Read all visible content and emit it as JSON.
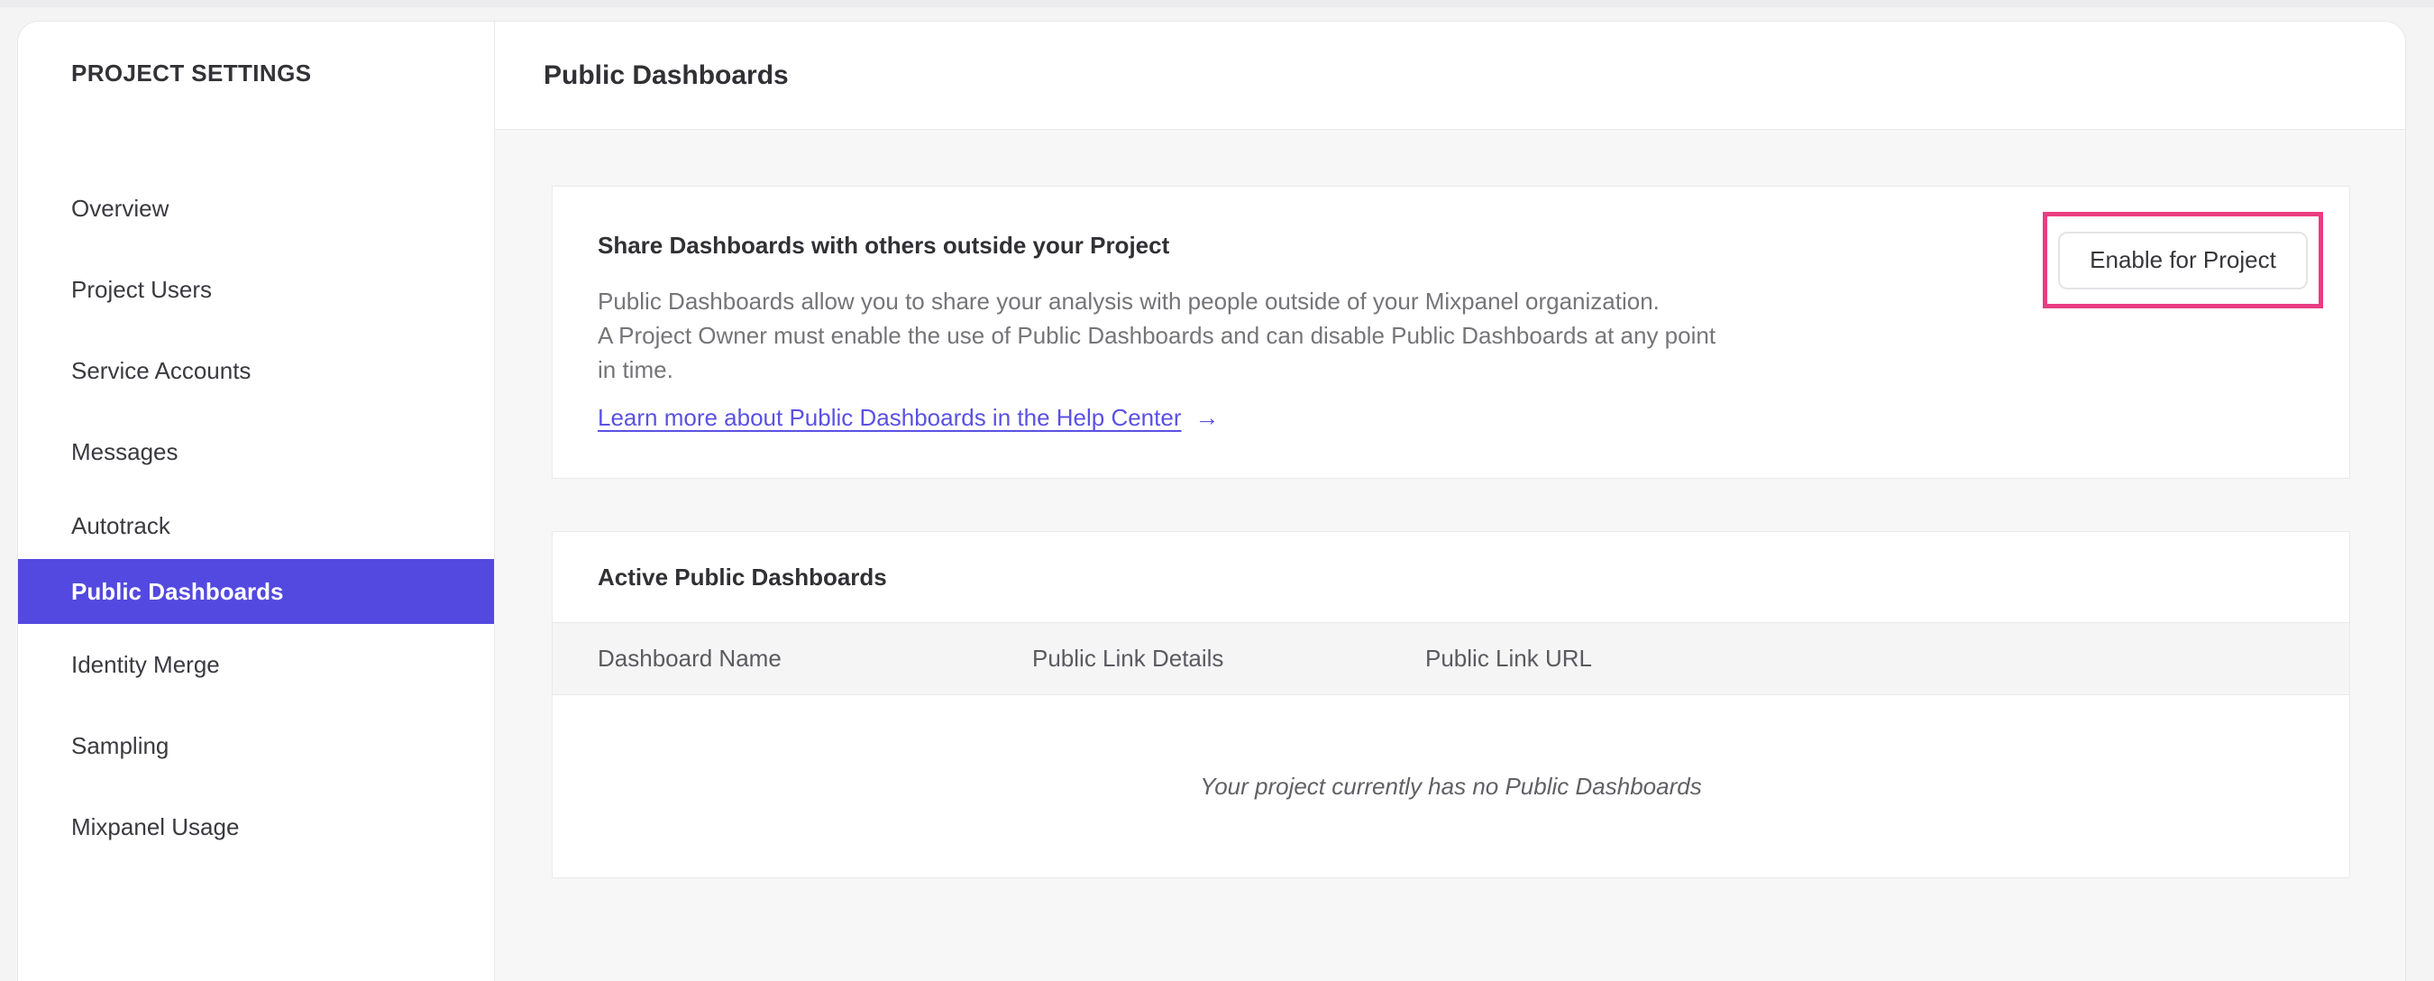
{
  "sidebar": {
    "title": "PROJECT SETTINGS",
    "items": [
      {
        "label": "Overview",
        "active": false
      },
      {
        "label": "Project Users",
        "active": false
      },
      {
        "label": "Service Accounts",
        "active": false
      },
      {
        "label": "Messages",
        "active": false
      },
      {
        "label": "Autotrack",
        "active": false
      },
      {
        "label": "Public Dashboards",
        "active": true
      },
      {
        "label": "Identity Merge",
        "active": false
      },
      {
        "label": "Sampling",
        "active": false
      },
      {
        "label": "Mixpanel Usage",
        "active": false
      }
    ]
  },
  "header": {
    "title": "Public Dashboards"
  },
  "share_card": {
    "heading": "Share Dashboards with others outside your Project",
    "body_lines": [
      "Public Dashboards allow you to share your analysis with people outside of your Mixpanel organization.",
      "A Project Owner must enable the use of Public Dashboards and can disable Public Dashboards at any point",
      "in time."
    ],
    "link_label": "Learn more about Public Dashboards in the Help Center",
    "link_arrow": "→",
    "enable_button_label": "Enable for Project"
  },
  "active_dashboards_card": {
    "title": "Active Public Dashboards",
    "columns": [
      "Dashboard Name",
      "Public Link Details",
      "Public Link URL"
    ],
    "empty_message": "Your project currently has no Public Dashboards"
  },
  "colors": {
    "accent_purple": "#5349e0",
    "link_purple": "#5b51e3",
    "highlight_pink": "#e93d81"
  }
}
